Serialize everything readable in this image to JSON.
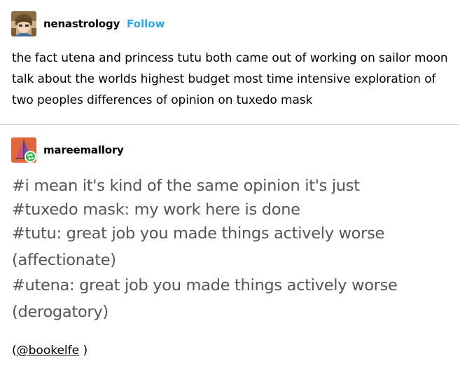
{
  "post": {
    "username": "nenastrology",
    "follow_label": "Follow",
    "body": "the fact utena and princess tutu both came out of working on sailor moon talk about the worlds highest budget most time intensive exploration of two peoples differences of opinion on tuxedo mask"
  },
  "reblog": {
    "username": "mareemallory",
    "tags": [
      "#i mean it's kind of the same opinion it's just",
      "#tuxedo mask: my work here is done",
      "#tutu: great job you made things actively worse",
      "(affectionate)",
      "#utena: great job you made things actively worse",
      "(derogatory)"
    ],
    "credit_prefix": "(",
    "credit_link": "@bookelfe",
    "credit_suffix": " )"
  },
  "colors": {
    "follow": "#2fa8e8",
    "tag_text": "#555555",
    "divider": "#d9d9d9",
    "reblog_badge": "#2bbd4e"
  }
}
